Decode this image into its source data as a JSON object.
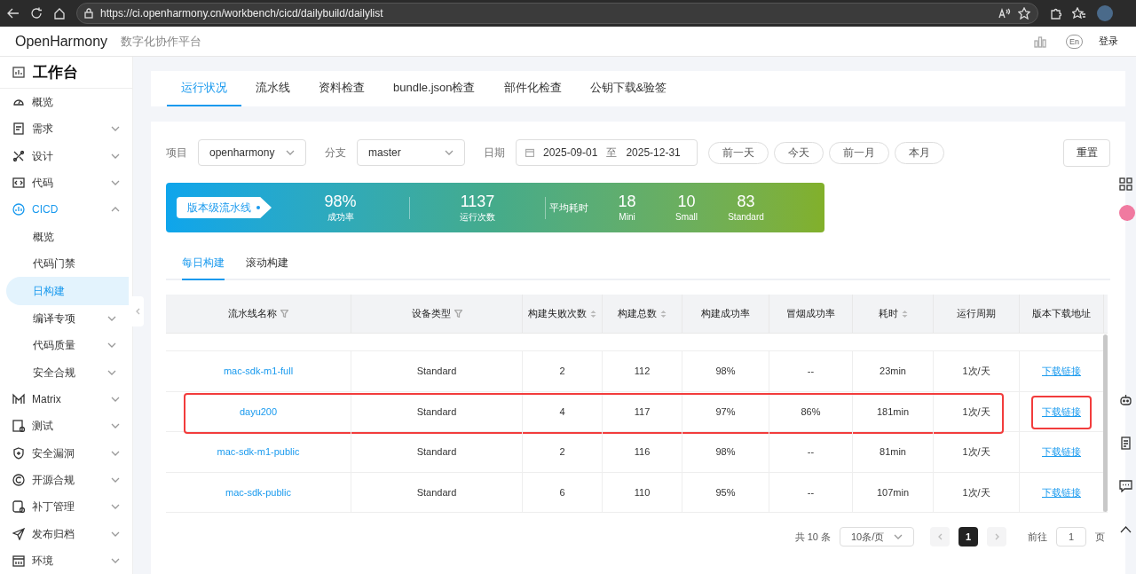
{
  "browser": {
    "url": "https://ci.openharmony.cn/workbench/cicd/dailybuild/dailylist"
  },
  "header": {
    "brand": "OpenHarmony",
    "subtitle": "数字化协作平台",
    "lang": "En",
    "login": "登录"
  },
  "sidebar": {
    "title": "工作台",
    "items": [
      {
        "label": "概览",
        "selected": false
      },
      {
        "label": "需求",
        "selected": false,
        "expanded": false
      },
      {
        "label": "设计",
        "selected": false,
        "expanded": false
      },
      {
        "label": "代码",
        "selected": false,
        "expanded": false
      },
      {
        "label": "CICD",
        "selected": true,
        "expanded": true,
        "children": [
          {
            "label": "概览",
            "selected": false
          },
          {
            "label": "代码门禁",
            "selected": false
          },
          {
            "label": "日构建",
            "selected": true
          },
          {
            "label": "编译专项",
            "selected": false,
            "expanded": false
          },
          {
            "label": "代码质量",
            "selected": false,
            "expanded": false
          },
          {
            "label": "安全合规",
            "selected": false,
            "expanded": false
          }
        ]
      },
      {
        "label": "Matrix",
        "selected": false,
        "expanded": false
      },
      {
        "label": "测试",
        "selected": false,
        "expanded": false
      },
      {
        "label": "安全漏洞",
        "selected": false,
        "expanded": false
      },
      {
        "label": "开源合规",
        "selected": false,
        "expanded": false
      },
      {
        "label": "补丁管理",
        "selected": false,
        "expanded": false
      },
      {
        "label": "发布归档",
        "selected": false,
        "expanded": false
      },
      {
        "label": "环境",
        "selected": false,
        "expanded": false
      }
    ]
  },
  "tabs": [
    {
      "label": "运行状况",
      "selected": true
    },
    {
      "label": "流水线",
      "selected": false
    },
    {
      "label": "资料检查",
      "selected": false
    },
    {
      "label": "bundle.json检查",
      "selected": false
    },
    {
      "label": "部件化检查",
      "selected": false
    },
    {
      "label": "公钥下载&验签",
      "selected": false
    }
  ],
  "filters": {
    "project_label": "项目",
    "project": "openharmony",
    "branch_label": "分支",
    "branch": "master",
    "date_label": "日期",
    "date_start": "2025-09-01",
    "date_sep": "至",
    "date_end": "2025-12-31",
    "quick": [
      "前一天",
      "今天",
      "前一月",
      "本月"
    ],
    "reset": "重置"
  },
  "banner": {
    "badge": "版本级流水线",
    "stats": [
      {
        "value": "98%",
        "label": "成功率"
      },
      {
        "value": "1137",
        "label": "运行次数"
      }
    ],
    "avg_label": "平均耗时",
    "avg": [
      {
        "value": "18",
        "label": "Mini"
      },
      {
        "value": "10",
        "label": "Small"
      },
      {
        "value": "83",
        "label": "Standard"
      }
    ]
  },
  "subtabs": [
    {
      "label": "每日构建",
      "selected": true
    },
    {
      "label": "滚动构建",
      "selected": false
    }
  ],
  "table": {
    "columns": [
      {
        "label": "流水线名称",
        "kind": "filter"
      },
      {
        "label": "设备类型",
        "kind": "filter"
      },
      {
        "label": "构建失败次数",
        "kind": "sort"
      },
      {
        "label": "构建总数",
        "kind": "sort"
      },
      {
        "label": "构建成功率",
        "kind": "plain"
      },
      {
        "label": "冒烟成功率",
        "kind": "plain"
      },
      {
        "label": "耗时",
        "kind": "sort"
      },
      {
        "label": "运行周期",
        "kind": "plain"
      },
      {
        "label": "版本下载地址",
        "kind": "plain"
      }
    ],
    "rows": [
      {
        "cells": [
          "mac-sdk-m1-full",
          "Standard",
          "2",
          "112",
          "98%",
          "--",
          "23min",
          "1次/天",
          "下载链接"
        ],
        "highlighted": false
      },
      {
        "cells": [
          "dayu200",
          "Standard",
          "4",
          "117",
          "97%",
          "86%",
          "181min",
          "1次/天",
          "下载链接"
        ],
        "highlighted": true
      },
      {
        "cells": [
          "mac-sdk-m1-public",
          "Standard",
          "2",
          "116",
          "98%",
          "--",
          "81min",
          "1次/天",
          "下载链接"
        ],
        "highlighted": false
      },
      {
        "cells": [
          "mac-sdk-public",
          "Standard",
          "6",
          "110",
          "95%",
          "--",
          "107min",
          "1次/天",
          "下载链接"
        ],
        "highlighted": false
      }
    ]
  },
  "pagination": {
    "total": "共 10 条",
    "page_size": "10条/页",
    "pages": [
      {
        "label": "1",
        "selected": true
      }
    ],
    "goto_label": "前往",
    "goto_value": "1",
    "goto_suffix": "页"
  }
}
